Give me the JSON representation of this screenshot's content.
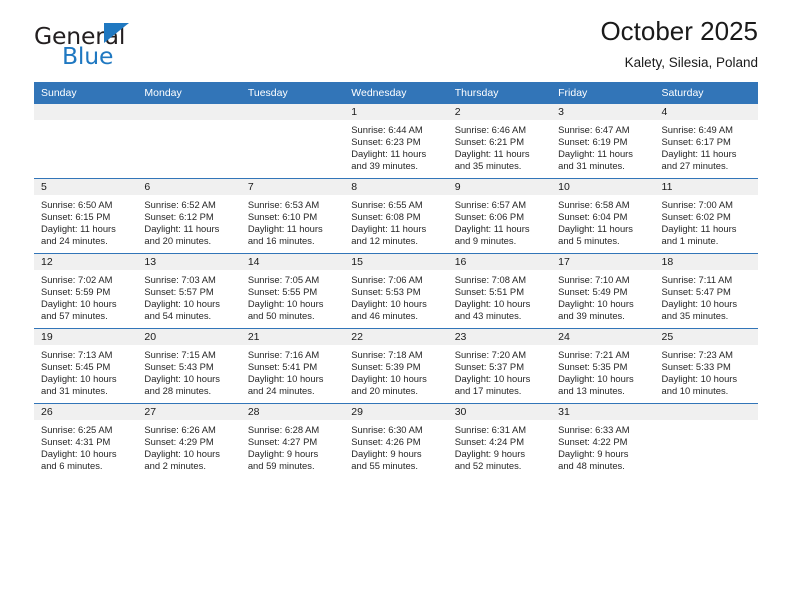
{
  "brand": {
    "name_top": "General",
    "name_bottom": "Blue",
    "flag_icon": "triangle-flag-icon",
    "accent_color": "#1f78c1"
  },
  "header": {
    "title": "October 2025",
    "location": "Kalety, Silesia, Poland"
  },
  "colors": {
    "header_blue": "#3275b8",
    "daynum_band": "#f0f0f0",
    "text": "#1a1a1a"
  },
  "weekday_headers": [
    "Sunday",
    "Monday",
    "Tuesday",
    "Wednesday",
    "Thursday",
    "Friday",
    "Saturday"
  ],
  "weeks": [
    [
      {
        "empty": true
      },
      {
        "empty": true
      },
      {
        "empty": true
      },
      {
        "day": "1",
        "sunrise": "Sunrise: 6:44 AM",
        "sunset": "Sunset: 6:23 PM",
        "daylight_line1": "Daylight: 11 hours",
        "daylight_line2": "and 39 minutes."
      },
      {
        "day": "2",
        "sunrise": "Sunrise: 6:46 AM",
        "sunset": "Sunset: 6:21 PM",
        "daylight_line1": "Daylight: 11 hours",
        "daylight_line2": "and 35 minutes."
      },
      {
        "day": "3",
        "sunrise": "Sunrise: 6:47 AM",
        "sunset": "Sunset: 6:19 PM",
        "daylight_line1": "Daylight: 11 hours",
        "daylight_line2": "and 31 minutes."
      },
      {
        "day": "4",
        "sunrise": "Sunrise: 6:49 AM",
        "sunset": "Sunset: 6:17 PM",
        "daylight_line1": "Daylight: 11 hours",
        "daylight_line2": "and 27 minutes."
      }
    ],
    [
      {
        "day": "5",
        "sunrise": "Sunrise: 6:50 AM",
        "sunset": "Sunset: 6:15 PM",
        "daylight_line1": "Daylight: 11 hours",
        "daylight_line2": "and 24 minutes."
      },
      {
        "day": "6",
        "sunrise": "Sunrise: 6:52 AM",
        "sunset": "Sunset: 6:12 PM",
        "daylight_line1": "Daylight: 11 hours",
        "daylight_line2": "and 20 minutes."
      },
      {
        "day": "7",
        "sunrise": "Sunrise: 6:53 AM",
        "sunset": "Sunset: 6:10 PM",
        "daylight_line1": "Daylight: 11 hours",
        "daylight_line2": "and 16 minutes."
      },
      {
        "day": "8",
        "sunrise": "Sunrise: 6:55 AM",
        "sunset": "Sunset: 6:08 PM",
        "daylight_line1": "Daylight: 11 hours",
        "daylight_line2": "and 12 minutes."
      },
      {
        "day": "9",
        "sunrise": "Sunrise: 6:57 AM",
        "sunset": "Sunset: 6:06 PM",
        "daylight_line1": "Daylight: 11 hours",
        "daylight_line2": "and 9 minutes."
      },
      {
        "day": "10",
        "sunrise": "Sunrise: 6:58 AM",
        "sunset": "Sunset: 6:04 PM",
        "daylight_line1": "Daylight: 11 hours",
        "daylight_line2": "and 5 minutes."
      },
      {
        "day": "11",
        "sunrise": "Sunrise: 7:00 AM",
        "sunset": "Sunset: 6:02 PM",
        "daylight_line1": "Daylight: 11 hours",
        "daylight_line2": "and 1 minute."
      }
    ],
    [
      {
        "day": "12",
        "sunrise": "Sunrise: 7:02 AM",
        "sunset": "Sunset: 5:59 PM",
        "daylight_line1": "Daylight: 10 hours",
        "daylight_line2": "and 57 minutes."
      },
      {
        "day": "13",
        "sunrise": "Sunrise: 7:03 AM",
        "sunset": "Sunset: 5:57 PM",
        "daylight_line1": "Daylight: 10 hours",
        "daylight_line2": "and 54 minutes."
      },
      {
        "day": "14",
        "sunrise": "Sunrise: 7:05 AM",
        "sunset": "Sunset: 5:55 PM",
        "daylight_line1": "Daylight: 10 hours",
        "daylight_line2": "and 50 minutes."
      },
      {
        "day": "15",
        "sunrise": "Sunrise: 7:06 AM",
        "sunset": "Sunset: 5:53 PM",
        "daylight_line1": "Daylight: 10 hours",
        "daylight_line2": "and 46 minutes."
      },
      {
        "day": "16",
        "sunrise": "Sunrise: 7:08 AM",
        "sunset": "Sunset: 5:51 PM",
        "daylight_line1": "Daylight: 10 hours",
        "daylight_line2": "and 43 minutes."
      },
      {
        "day": "17",
        "sunrise": "Sunrise: 7:10 AM",
        "sunset": "Sunset: 5:49 PM",
        "daylight_line1": "Daylight: 10 hours",
        "daylight_line2": "and 39 minutes."
      },
      {
        "day": "18",
        "sunrise": "Sunrise: 7:11 AM",
        "sunset": "Sunset: 5:47 PM",
        "daylight_line1": "Daylight: 10 hours",
        "daylight_line2": "and 35 minutes."
      }
    ],
    [
      {
        "day": "19",
        "sunrise": "Sunrise: 7:13 AM",
        "sunset": "Sunset: 5:45 PM",
        "daylight_line1": "Daylight: 10 hours",
        "daylight_line2": "and 31 minutes."
      },
      {
        "day": "20",
        "sunrise": "Sunrise: 7:15 AM",
        "sunset": "Sunset: 5:43 PM",
        "daylight_line1": "Daylight: 10 hours",
        "daylight_line2": "and 28 minutes."
      },
      {
        "day": "21",
        "sunrise": "Sunrise: 7:16 AM",
        "sunset": "Sunset: 5:41 PM",
        "daylight_line1": "Daylight: 10 hours",
        "daylight_line2": "and 24 minutes."
      },
      {
        "day": "22",
        "sunrise": "Sunrise: 7:18 AM",
        "sunset": "Sunset: 5:39 PM",
        "daylight_line1": "Daylight: 10 hours",
        "daylight_line2": "and 20 minutes."
      },
      {
        "day": "23",
        "sunrise": "Sunrise: 7:20 AM",
        "sunset": "Sunset: 5:37 PM",
        "daylight_line1": "Daylight: 10 hours",
        "daylight_line2": "and 17 minutes."
      },
      {
        "day": "24",
        "sunrise": "Sunrise: 7:21 AM",
        "sunset": "Sunset: 5:35 PM",
        "daylight_line1": "Daylight: 10 hours",
        "daylight_line2": "and 13 minutes."
      },
      {
        "day": "25",
        "sunrise": "Sunrise: 7:23 AM",
        "sunset": "Sunset: 5:33 PM",
        "daylight_line1": "Daylight: 10 hours",
        "daylight_line2": "and 10 minutes."
      }
    ],
    [
      {
        "day": "26",
        "sunrise": "Sunrise: 6:25 AM",
        "sunset": "Sunset: 4:31 PM",
        "daylight_line1": "Daylight: 10 hours",
        "daylight_line2": "and 6 minutes."
      },
      {
        "day": "27",
        "sunrise": "Sunrise: 6:26 AM",
        "sunset": "Sunset: 4:29 PM",
        "daylight_line1": "Daylight: 10 hours",
        "daylight_line2": "and 2 minutes."
      },
      {
        "day": "28",
        "sunrise": "Sunrise: 6:28 AM",
        "sunset": "Sunset: 4:27 PM",
        "daylight_line1": "Daylight: 9 hours",
        "daylight_line2": "and 59 minutes."
      },
      {
        "day": "29",
        "sunrise": "Sunrise: 6:30 AM",
        "sunset": "Sunset: 4:26 PM",
        "daylight_line1": "Daylight: 9 hours",
        "daylight_line2": "and 55 minutes."
      },
      {
        "day": "30",
        "sunrise": "Sunrise: 6:31 AM",
        "sunset": "Sunset: 4:24 PM",
        "daylight_line1": "Daylight: 9 hours",
        "daylight_line2": "and 52 minutes."
      },
      {
        "day": "31",
        "sunrise": "Sunrise: 6:33 AM",
        "sunset": "Sunset: 4:22 PM",
        "daylight_line1": "Daylight: 9 hours",
        "daylight_line2": "and 48 minutes."
      },
      {
        "empty": true
      }
    ]
  ]
}
